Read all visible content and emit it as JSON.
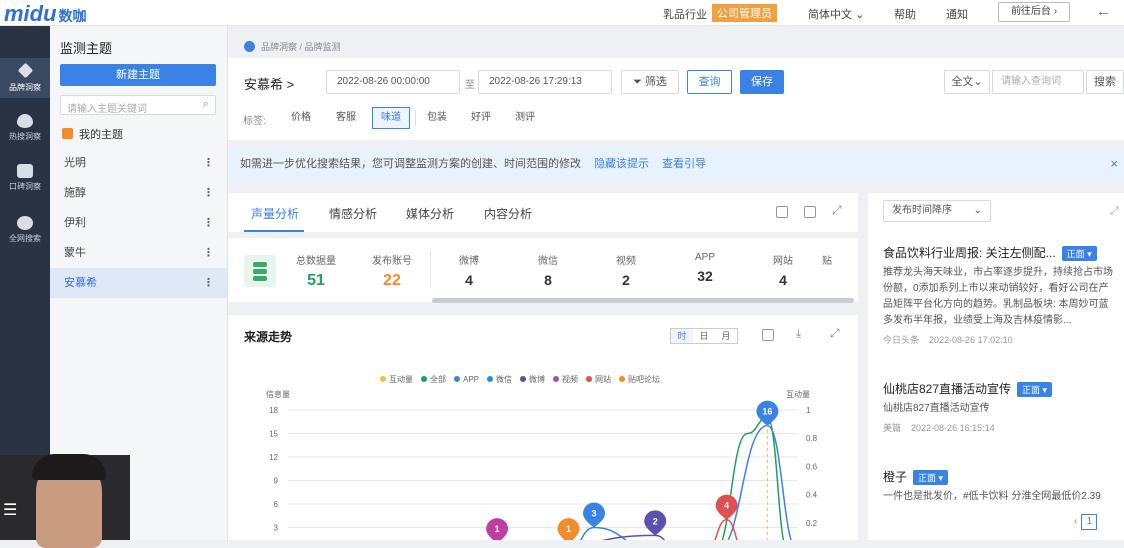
{
  "app": {
    "logo": "midu",
    "logo_cn": "数咖"
  },
  "topnav": {
    "industry": "乳品行业",
    "company_badge": "公司管理员",
    "language": "简体中文",
    "help": "帮助",
    "notice": "通知",
    "goto_backend": "前往后台",
    "back_icon": "arrow-left-icon"
  },
  "sidebar": [
    {
      "label": "品牌洞察",
      "icon": "diamond-icon",
      "active": true
    },
    {
      "label": "热搜洞察",
      "icon": "flame-icon"
    },
    {
      "label": "口碑洞察",
      "icon": "thumb-up-icon"
    },
    {
      "label": "全网搜索",
      "icon": "search-icon"
    }
  ],
  "topics": {
    "title": "监测主题",
    "new_button": "新建主题",
    "search_placeholder": "请输入主题关键词",
    "my_topics": "我的主题",
    "items": [
      {
        "label": "光明"
      },
      {
        "label": "施醇"
      },
      {
        "label": "伊利"
      },
      {
        "label": "蒙牛"
      },
      {
        "label": "安慕希",
        "active": true
      }
    ]
  },
  "breadcrumb": "品牌洞察 / 品牌监测",
  "toolbar": {
    "brand": "安慕希 >",
    "start": "2022-08-26 00:00:00",
    "to": "至",
    "end": "2022-08-26 17:29:13",
    "filter": "筛选",
    "query": "查询",
    "save": "保存",
    "fulltext": "全文",
    "search_placeholder": "请输入查询词",
    "search": "搜索"
  },
  "tags": {
    "label": "标签:",
    "items": [
      "价格",
      "客服",
      "味道",
      "包装",
      "好评",
      "测评"
    ],
    "active_index": 2
  },
  "notice": {
    "text": "如需进一步优化搜索结果，您可调整监测方案的创建、时间范围的修改",
    "hide": "隐藏该提示",
    "guide": "查看引导",
    "close": "×"
  },
  "tabs": [
    "声量分析",
    "情感分析",
    "媒体分析",
    "内容分析"
  ],
  "stats": {
    "total_label": "总数据量",
    "total": "51",
    "accounts_label": "发布账号",
    "accounts": "22",
    "channels": [
      {
        "label": "微博",
        "value": "4"
      },
      {
        "label": "微信",
        "value": "8"
      },
      {
        "label": "视频",
        "value": "2"
      },
      {
        "label": "APP",
        "value": "32"
      },
      {
        "label": "网站",
        "value": "4"
      },
      {
        "label": "贴",
        "value": ""
      }
    ]
  },
  "chart_panel": {
    "title": "来源走势",
    "granularity": [
      "时",
      "日",
      "月"
    ],
    "active": "时"
  },
  "chart_data": {
    "type": "line",
    "ylabel": "信息量",
    "y2label": "互动量",
    "yticks": [
      "18",
      "15",
      "12",
      "9",
      "6",
      "3"
    ],
    "y2ticks": [
      "1",
      "0.8",
      "0.6",
      "0.4",
      "0.2"
    ],
    "ylim": [
      0,
      18
    ],
    "y2lim": [
      0,
      1
    ],
    "legend": [
      {
        "name": "互动量",
        "color": "#f0c040"
      },
      {
        "name": "全部",
        "color": "#22a05a"
      },
      {
        "name": "APP",
        "color": "#3a82e6"
      },
      {
        "name": "微信",
        "color": "#2b8fd6"
      },
      {
        "name": "微博",
        "color": "#5b4fb0"
      },
      {
        "name": "视频",
        "color": "#a050c0"
      },
      {
        "name": "网站",
        "color": "#e05050"
      },
      {
        "name": "贴吧论坛",
        "color": "#f08c2a"
      }
    ],
    "markers": [
      {
        "label": "1",
        "color": "#c03f9e",
        "x": 0.41,
        "y": 1
      },
      {
        "label": "1",
        "color": "#f08c2a",
        "x": 0.55,
        "y": 1
      },
      {
        "label": "3",
        "color": "#3a82e6",
        "x": 0.6,
        "y": 3
      },
      {
        "label": "2",
        "color": "#5b4fb0",
        "x": 0.72,
        "y": 2
      },
      {
        "label": "4",
        "color": "#e05050",
        "x": 0.86,
        "y": 4
      },
      {
        "label": "16",
        "color": "#3a82e6",
        "x": 0.94,
        "y": 16
      }
    ]
  },
  "right": {
    "sort": "发布时间降序",
    "articles": [
      {
        "title": "食品饮料行业周报: 关注左侧配...",
        "tag": "正面",
        "body": "推荐龙头海天味业，市占率逐步提升，持续抢占市场份额，0添加系列上市以来动销较好，看好公司在产品矩阵平台化方向的趋势。乳制品板块: 本周妙可蓝多发布半年报，业绩受上海及吉林疫情影...",
        "source": "今日头条",
        "time": "2022-08-26 17:02:10"
      },
      {
        "title": "仙桃店827直播活动宣传",
        "tag": "正面",
        "body": "仙桃店827直播活动宣传",
        "source": "美篇",
        "time": "2022-08-26 16:15:14"
      },
      {
        "title": "橙子",
        "tag": "正面",
        "body": "一件也是批发价，#低卡饮料 分淮全网最低价2.39",
        "source": "",
        "time": ""
      }
    ],
    "page": "1"
  }
}
